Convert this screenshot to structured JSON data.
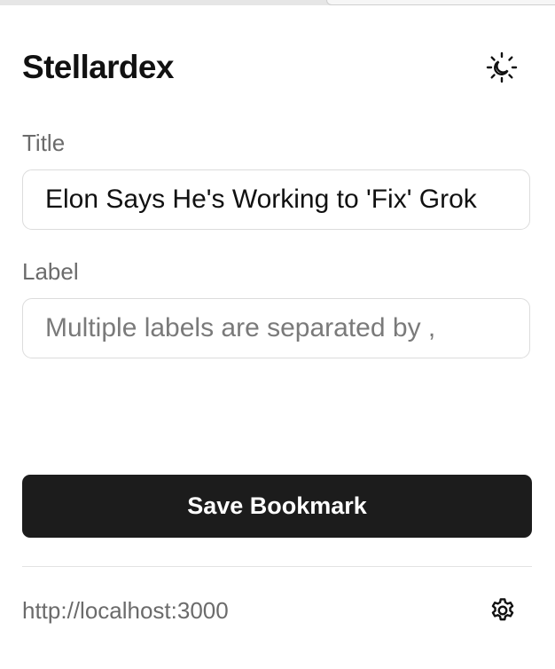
{
  "header": {
    "app_title": "Stellardex",
    "theme_toggle_icon": "sun-moon-icon"
  },
  "form": {
    "title_label": "Title",
    "title_value": "Elon Says He's Working to 'Fix' Grok",
    "label_label": "Label",
    "label_value": "",
    "label_placeholder": "Multiple labels are separated by ,"
  },
  "actions": {
    "save_label": "Save Bookmark"
  },
  "footer": {
    "server_url": "http://localhost:3000",
    "settings_icon": "gear-icon"
  },
  "colors": {
    "primary_button": "#1c1c1c",
    "muted_text": "#6b6b6b",
    "border": "#dcdcdc"
  }
}
